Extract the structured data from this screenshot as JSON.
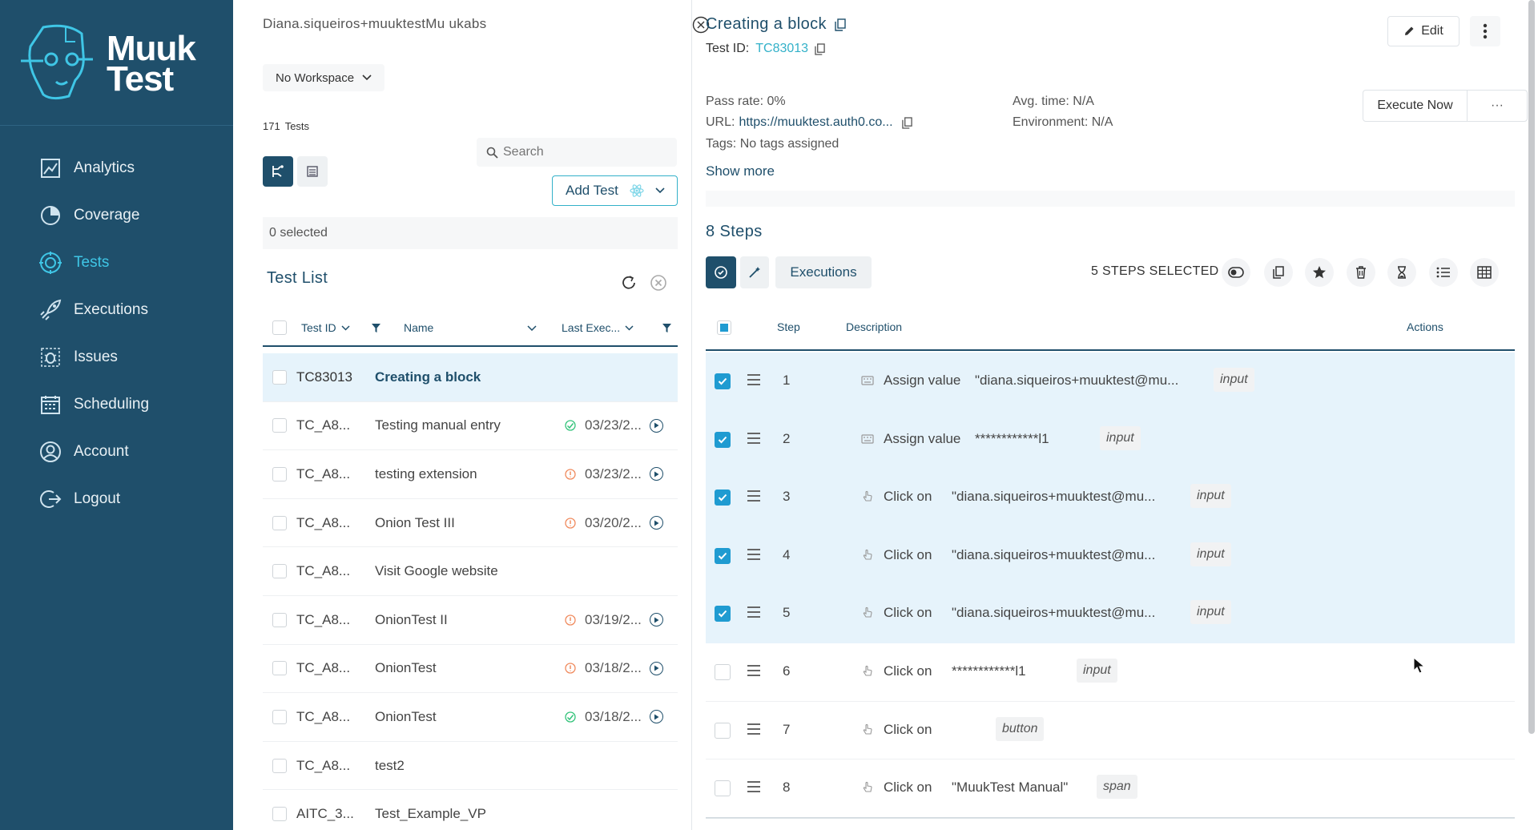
{
  "brand": {
    "word1": "Muuk",
    "word2": "Test",
    "color": "#1f4f6b",
    "accent": "#3fc6e6"
  },
  "nav": [
    {
      "label": "Analytics",
      "icon": "analytics-icon",
      "active": false
    },
    {
      "label": "Coverage",
      "icon": "coverage-icon",
      "active": false
    },
    {
      "label": "Tests",
      "icon": "tests-icon",
      "active": true
    },
    {
      "label": "Executions",
      "icon": "rocket-icon",
      "active": false
    },
    {
      "label": "Issues",
      "icon": "bug-icon",
      "active": false
    },
    {
      "label": "Scheduling",
      "icon": "calendar-icon",
      "active": false
    },
    {
      "label": "Account",
      "icon": "user-icon",
      "active": false
    },
    {
      "label": "Logout",
      "icon": "logout-icon",
      "active": false
    }
  ],
  "list": {
    "user": "Diana.siqueiros+muuktestMu ukabs",
    "workspace": "No Workspace",
    "tests_count": "171",
    "tests_label": "Tests",
    "search_placeholder": "Search",
    "add_test": "Add Test",
    "selected": "0 selected",
    "title": "Test List",
    "headers": {
      "id": "Test ID",
      "name": "Name",
      "last": "Last Exec..."
    },
    "rows": [
      {
        "id": "TC83013",
        "name": "Creating a block",
        "status": "",
        "date": "",
        "active": true
      },
      {
        "id": "TC_A8...",
        "name": "Testing manual entry",
        "status": "pass",
        "date": "03/23/2...",
        "active": false
      },
      {
        "id": "TC_A8...",
        "name": "testing extension",
        "status": "warn",
        "date": "03/23/2...",
        "active": false
      },
      {
        "id": "TC_A8...",
        "name": "Onion Test III",
        "status": "warn",
        "date": "03/20/2...",
        "active": false
      },
      {
        "id": "TC_A8...",
        "name": "Visit Google website",
        "status": "",
        "date": "",
        "active": false
      },
      {
        "id": "TC_A8...",
        "name": "OnionTest II",
        "status": "warn",
        "date": "03/19/2...",
        "active": false
      },
      {
        "id": "TC_A8...",
        "name": "OnionTest",
        "status": "warn",
        "date": "03/18/2...",
        "active": false
      },
      {
        "id": "TC_A8...",
        "name": "OnionTest",
        "status": "pass",
        "date": "03/18/2...",
        "active": false
      },
      {
        "id": "TC_A8...",
        "name": "test2",
        "status": "",
        "date": "",
        "active": false
      },
      {
        "id": "AITC_3...",
        "name": "Test_Example_VP",
        "status": "",
        "date": "",
        "active": false
      }
    ]
  },
  "detail": {
    "title": "Creating a block",
    "test_id_label": "Test ID:",
    "test_id": "TC83013",
    "edit": "Edit",
    "pass_rate": "Pass rate: 0%",
    "avg_time": "Avg. time: N/A",
    "url_label": "URL:",
    "url": "https://muuktest.auth0.co...",
    "environment": "Environment: N/A",
    "tags": "Tags: No tags assigned",
    "execute_now": "Execute Now",
    "show_more": "Show more",
    "steps_title": "8 Steps",
    "executions_btn": "Executions",
    "steps_selected": "5 STEPS SELECTED",
    "headers": {
      "step": "Step",
      "description": "Description",
      "actions": "Actions"
    },
    "steps": [
      {
        "num": "1",
        "icon": "keyboard-icon",
        "action": "Assign value",
        "value": "\"diana.siqueiros+muuktest@mu...",
        "tag": "input",
        "selected": true
      },
      {
        "num": "2",
        "icon": "keyboard-icon",
        "action": "Assign value",
        "value": "************l1",
        "tag": "input",
        "selected": true
      },
      {
        "num": "3",
        "icon": "pointer-icon",
        "action": "Click on",
        "value": "\"diana.siqueiros+muuktest@mu...",
        "tag": "input",
        "selected": true
      },
      {
        "num": "4",
        "icon": "pointer-icon",
        "action": "Click on",
        "value": "\"diana.siqueiros+muuktest@mu...",
        "tag": "input",
        "selected": true
      },
      {
        "num": "5",
        "icon": "pointer-icon",
        "action": "Click on",
        "value": "\"diana.siqueiros+muuktest@mu...",
        "tag": "input",
        "selected": true
      },
      {
        "num": "6",
        "icon": "pointer-icon",
        "action": "Click on",
        "value": "************l1",
        "tag": "input",
        "selected": false
      },
      {
        "num": "7",
        "icon": "pointer-icon",
        "action": "Click on",
        "value": "",
        "tag": "button",
        "selected": false
      },
      {
        "num": "8",
        "icon": "pointer-icon",
        "action": "Click on",
        "value": "\"MuukTest Manual\"",
        "tag": "span",
        "selected": false
      }
    ]
  }
}
